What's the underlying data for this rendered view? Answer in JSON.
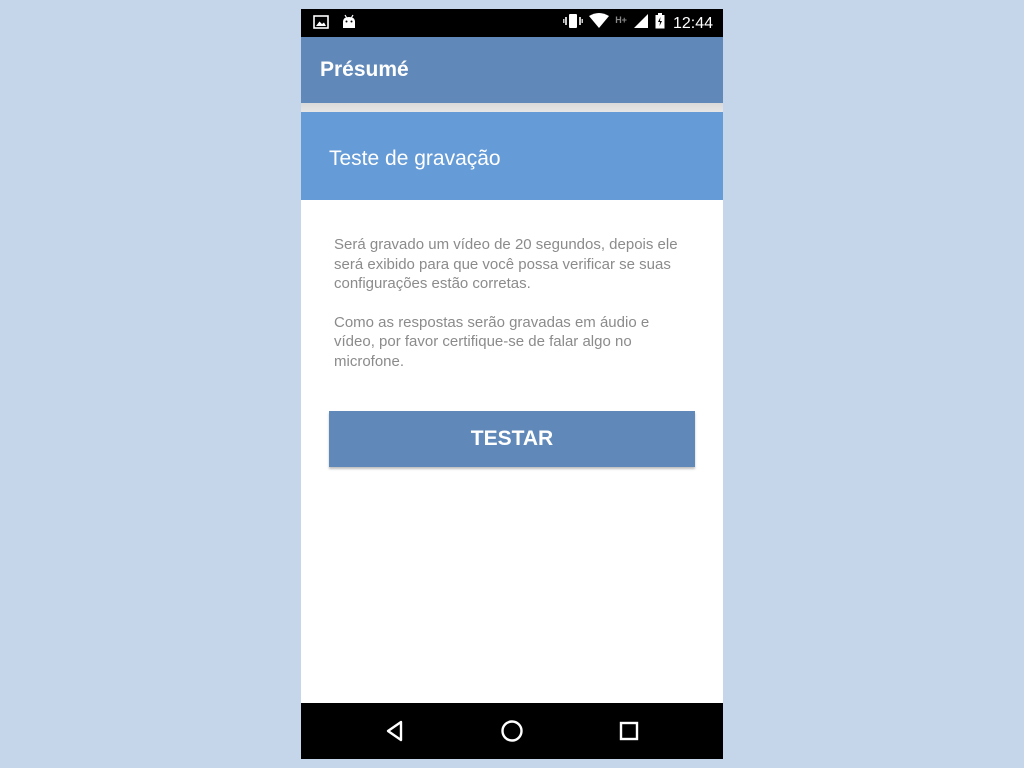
{
  "status_bar": {
    "time": "12:44",
    "network_type": "H+",
    "icons": [
      "image-icon",
      "android-icon",
      "vibrate-icon",
      "wifi-icon",
      "signal-icon",
      "battery-icon"
    ]
  },
  "app_bar": {
    "title": "Présumé"
  },
  "card": {
    "title": "Teste de gravação",
    "paragraphs": [
      "Será gravado um vídeo de 20 segundos, depois ele será exibido para que você possa verificar se suas configurações estão corretas.",
      "Como as respostas serão gravadas em áudio e vídeo, por favor certifique-se de falar algo no microfone."
    ],
    "button_label": "TESTAR"
  },
  "nav_bar": {
    "icons": [
      "back-icon",
      "home-icon",
      "recents-icon"
    ]
  },
  "colors": {
    "background": "#c5d6ea",
    "app_bar": "#6089b9",
    "card_header": "#659bd6",
    "button": "#6089b9",
    "body_text": "#8b8b8b"
  }
}
